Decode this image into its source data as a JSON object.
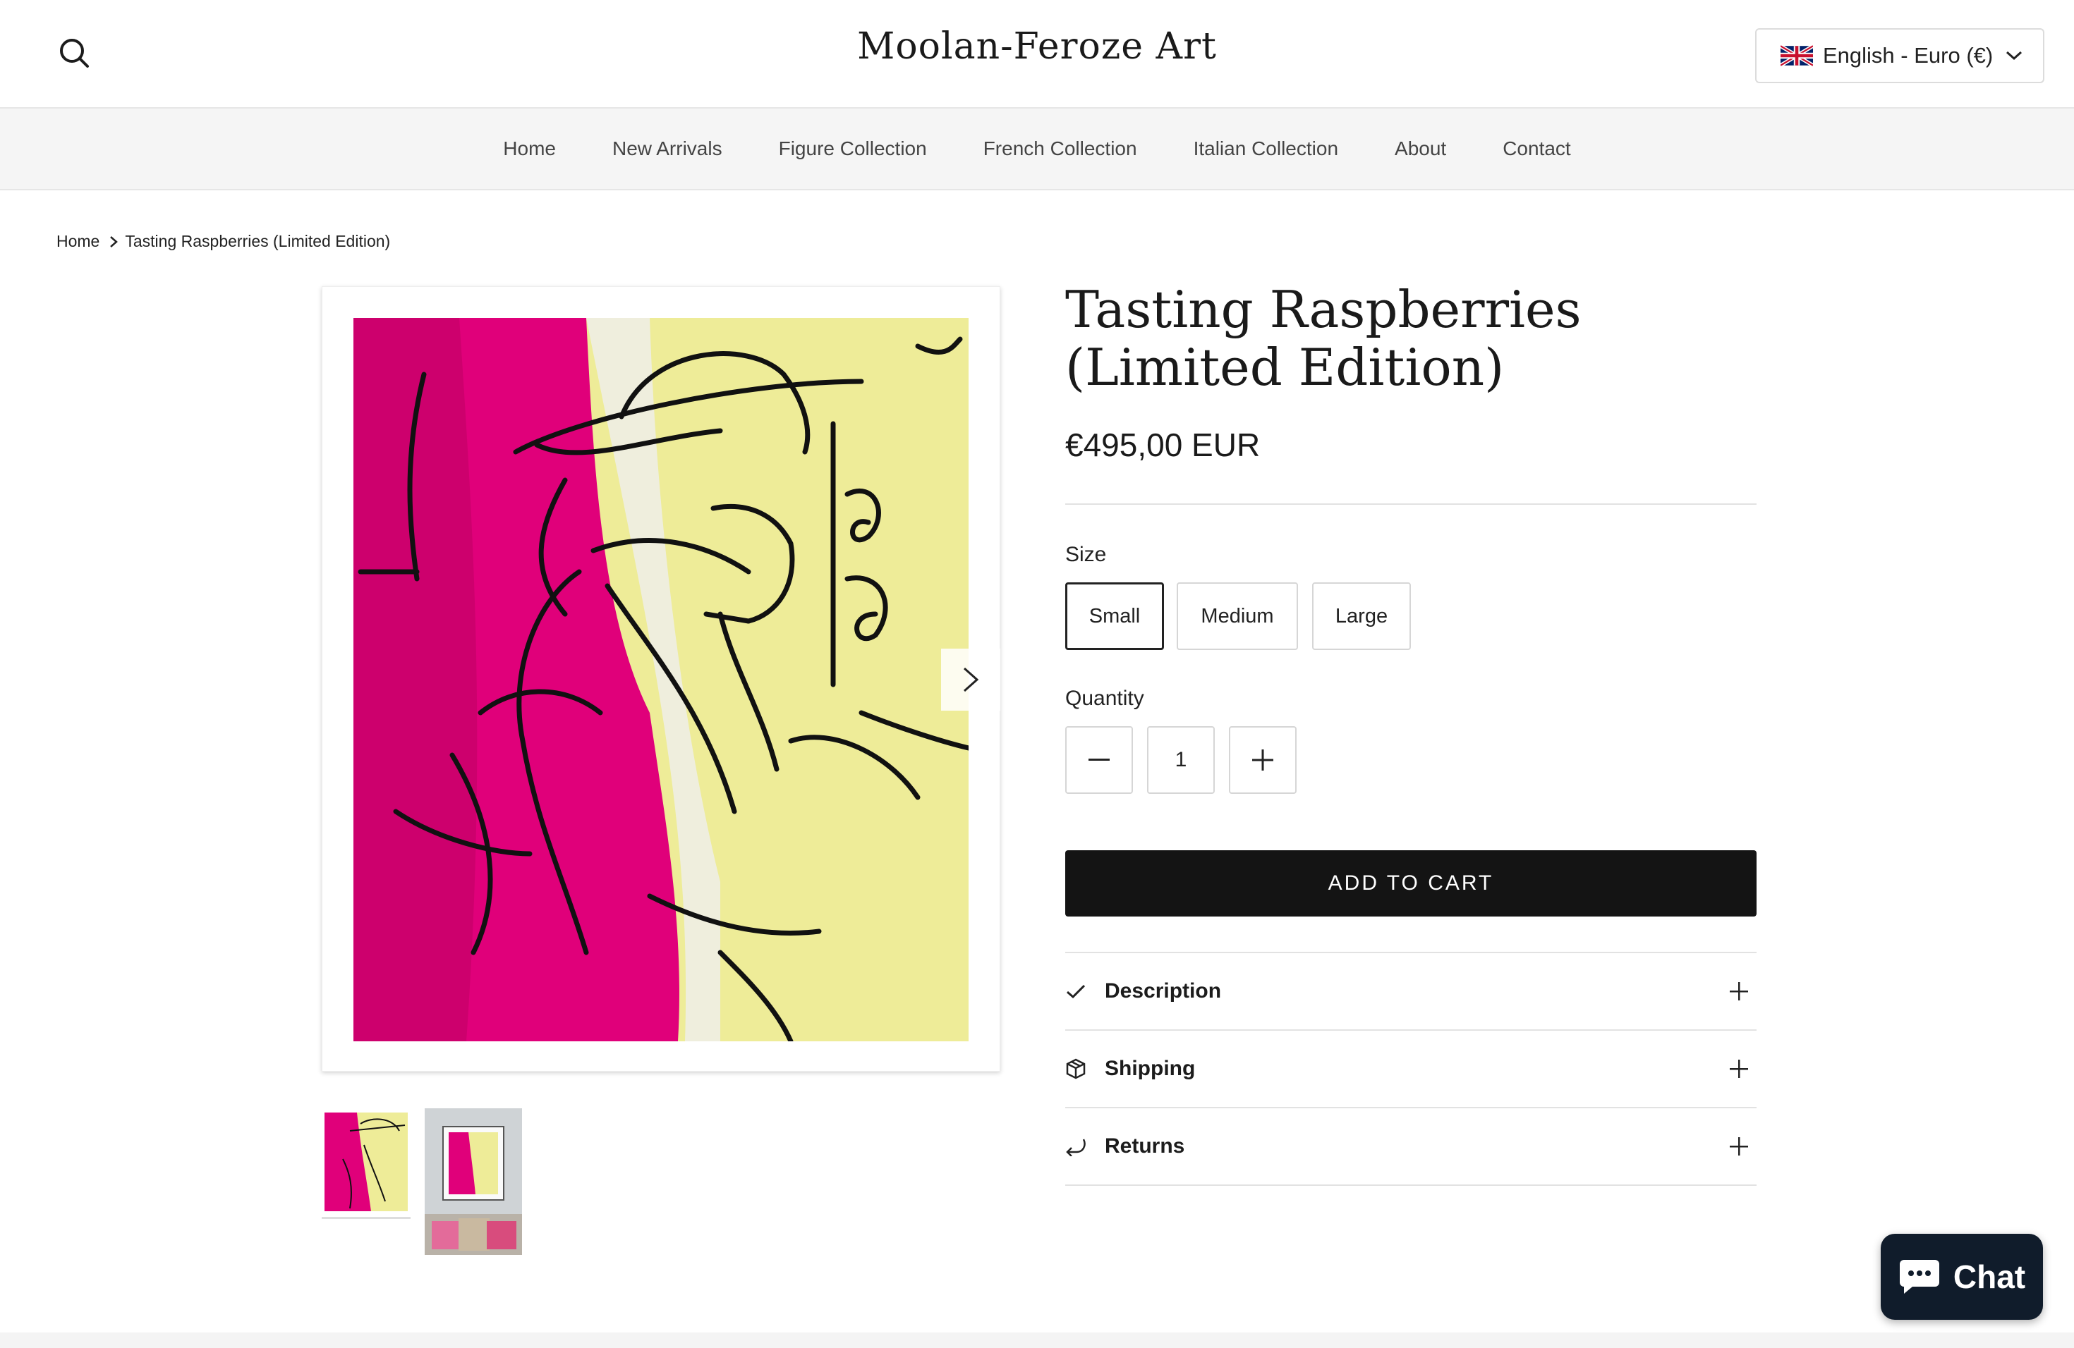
{
  "header": {
    "logo": "Moolan-Feroze Art",
    "currency_selector": "English - Euro (€)"
  },
  "nav": {
    "items": [
      "Home",
      "New Arrivals",
      "Figure Collection",
      "French Collection",
      "Italian Collection",
      "About",
      "Contact"
    ]
  },
  "breadcrumb": {
    "home": "Home",
    "current": "Tasting Raspberries (Limited Edition)"
  },
  "product": {
    "title": "Tasting Raspberries (Limited Edition)",
    "price": "€495,00 EUR",
    "size_label": "Size",
    "sizes": [
      "Small",
      "Medium",
      "Large"
    ],
    "selected_size": "Small",
    "quantity_label": "Quantity",
    "quantity": "1",
    "add_to_cart": "ADD TO CART"
  },
  "accordion": [
    {
      "label": "Description",
      "icon": "check-icon"
    },
    {
      "label": "Shipping",
      "icon": "box-icon"
    },
    {
      "label": "Returns",
      "icon": "return-arrow-icon"
    }
  ],
  "chat": {
    "label": "Chat"
  },
  "colors": {
    "art_magenta": "#e0007a",
    "art_yellow": "#eeec98",
    "button_dark": "#141414",
    "chat_bg": "#101c2b"
  }
}
